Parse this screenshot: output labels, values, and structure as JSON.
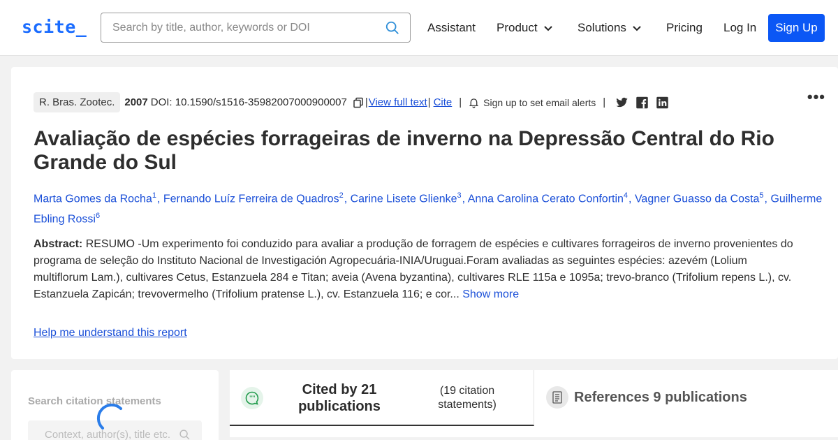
{
  "header": {
    "logo": "scite_",
    "search_placeholder": "Search by title, author, keywords or DOI",
    "nav": {
      "assistant": "Assistant",
      "product": "Product",
      "solutions": "Solutions",
      "pricing": "Pricing",
      "login": "Log In",
      "signup": "Sign Up"
    }
  },
  "paper": {
    "journal": "R. Bras. Zootec.",
    "year": "2007",
    "doi": "DOI: 10.1590/s1516-35982007000900007",
    "view_full_text": "View full text",
    "cite": "Cite",
    "alerts": "Sign up to set email alerts",
    "title": "Avaliação de espécies forrageiras de inverno na Depressão Central do Rio Grande do Sul",
    "authors": [
      {
        "name": "Marta Gomes da Rocha",
        "sup": "1"
      },
      {
        "name": "Fernando Luíz Ferreira de Quadros",
        "sup": "2"
      },
      {
        "name": "Carine Lisete Glienke",
        "sup": "3"
      },
      {
        "name": "Anna Carolina Cerato Confortin",
        "sup": "4"
      },
      {
        "name": "Vagner Guasso da Costa",
        "sup": "5"
      },
      {
        "name": "Guilherme Ebling Rossi",
        "sup": "6"
      }
    ],
    "abstract_label": "Abstract:",
    "abstract_text": "RESUMO -Um experimento foi conduzido para avaliar a produção de forragem de espécies e cultivares forrageiros de inverno provenientes do programa de seleção do Instituto Nacional de Investigación Agropecuária-INIA/Uruguai.Foram avaliadas as seguintes espécies: azevém (Lolium multiflorum Lam.), cultivares Cetus, Estanzuela 284 e Titan; aveia (Avena byzantina), cultivares RLE 115a e 1095a; trevo-branco (Trifolium repens L.), cv. Estanzuela Zapicán; trevovermelho (Trifolium pratense L.), cv. Estanzuela 116; e cor...",
    "show_more": "Show more",
    "help_link": "Help me understand this report"
  },
  "citation_search": {
    "label": "Search citation statements",
    "placeholder": "Context, author(s), title etc."
  },
  "tabs": {
    "cited_by": "Cited by 21 publications",
    "citation_statements": "(19 citation statements)",
    "references": "References 9 publications"
  },
  "colors": {
    "brand": "#1a6cff",
    "signup_bg": "#0b57f5",
    "link": "#1a4fd8"
  }
}
